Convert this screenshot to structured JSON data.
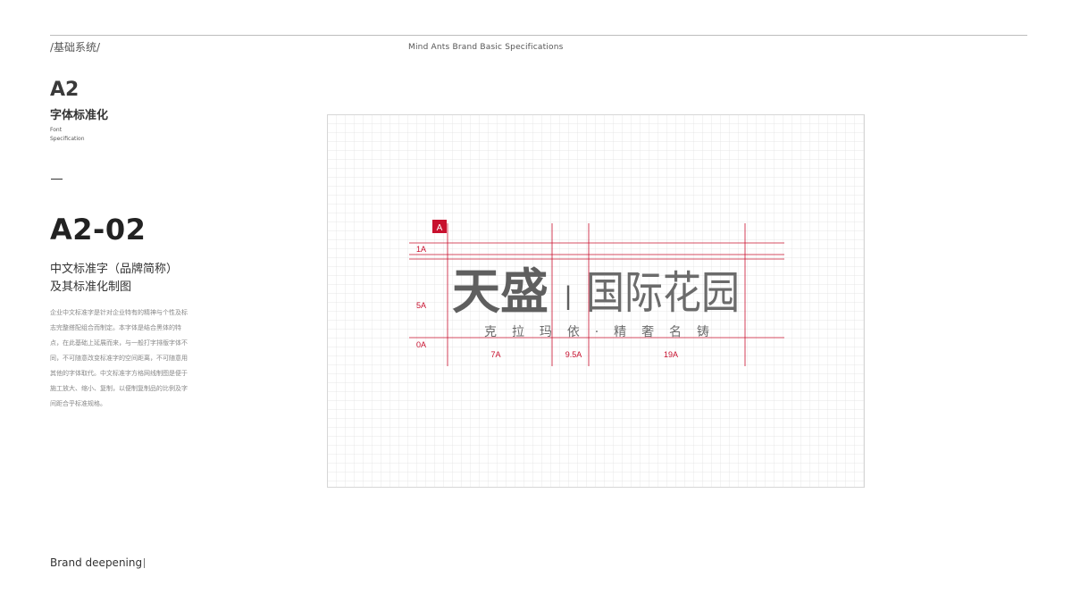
{
  "header": {
    "section_label": "/基础系统/",
    "title": "Mind Ants Brand Basic Specifications"
  },
  "chapter": {
    "code": "A2",
    "title": "字体标准化",
    "subtitle_line1": "Font",
    "subtitle_line2": "Specification"
  },
  "page": {
    "code": "A2-02",
    "heading_line1": "中文标准字（品牌简称）",
    "heading_line2": "及其标准化制图",
    "description": "企业中文标准字是针对企业特有的精神与个性及标志完整搭配组合而制定。本字体是结合黑体的特点，在此基础上延展而来，与一般打字排版字体不同，不可随意改变标准字的空间距离，不可随意用其他的字体取代。中文标准字方格网线制图是便于施工放大、缩小、复制，以便制复制品的比例及字间距合乎标准规格。"
  },
  "diagram": {
    "unit_marker": "A",
    "labels": {
      "row_top": "1A",
      "row_middle": "5A",
      "row_bottom": "0A",
      "col_left": "7A",
      "col_middle": "9.5A",
      "col_right": "19A"
    },
    "brand_left": "天盛",
    "brand_separator": "|",
    "brand_right": "国际花园",
    "tagline": "克 拉 玛 依 · 精 奢 名 铸",
    "colors": {
      "accent": "#c8102e",
      "grid": "#e2e2e2",
      "logo": "#6b6b6b"
    }
  },
  "footer": {
    "brand": "Brand deepening"
  }
}
